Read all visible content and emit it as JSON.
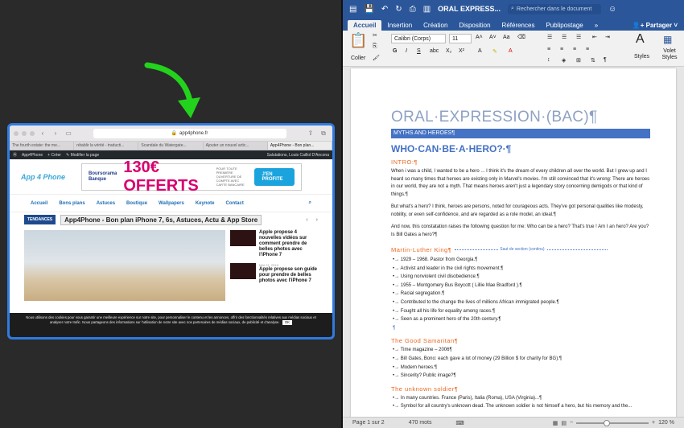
{
  "safari": {
    "url": "app4phone.fr",
    "tabs": [
      "The fourth estate: the me...",
      "rétablir la vérité - traducti...",
      "Scandale du Watergate...",
      "Ajouter un nouvel artic...",
      "App4Phone - Bon plan..."
    ],
    "wp_bar": {
      "site": "App4Phone",
      "new": "Créer",
      "edit": "Modifier la page",
      "greeting": "Salutations, Louis Caillol D'Ancona"
    },
    "logo": "App 4 Phone",
    "ad": {
      "bank": "Boursorama Banque",
      "big": "130€ OFFERTS",
      "small": "POUR TOUTE PREMIÈRE OUVERTURE DE COMPTE AVEC CARTE BANCAIRE",
      "cta": "J'EN PROFITE"
    },
    "nav": [
      "Accueil",
      "Bons plans",
      "Astuces",
      "Boutique",
      "Wallpapers",
      "Keynote",
      "Contact"
    ],
    "trend_label": "TENDANCES",
    "trend_title": "App4Phone - Bon plan iPhone 7, 6s, Astuces, Actu & App Store",
    "side": [
      {
        "text": "Apple propose 4 nouvelles vidéos sur comment prendre de belles photos avec l'iPhone 7",
        "date": ""
      },
      {
        "text": "Apple propose son guide pour prendre de belles photos avec l'iPhone 7",
        "date": "MAI 21, 2019"
      }
    ],
    "cookie": "Nous utilisons des cookies pour vous garantir une meilleure expérience sur notre site, pour personnaliser le contenu et les annonces, offrir des fonctionnalités relatives aux médias sociaux et analyser notre trafic. Nous partageons des informations sur l'utilisation de notre site avec nos partenaires de médias sociaux, de publicité et d'analyse.",
    "cookie_ok": "OK"
  },
  "word": {
    "doc_title": "ORAL EXPRESS...",
    "search_placeholder": "Rechercher dans le document",
    "tabs": [
      "Accueil",
      "Insertion",
      "Création",
      "Disposition",
      "Références",
      "Publipostage"
    ],
    "share": "Partager",
    "ribbon": {
      "paste": "Coller",
      "font": "Calibri (Corps)",
      "size": "11",
      "styles": "Styles",
      "pane": "Volet Styles"
    },
    "doc": {
      "h1": "ORAL·EXPRESSION·(BAC)¶",
      "banner": "MYTHS AND HEROES¶",
      "h2": "WHO·CAN·BE·A·HERO?·¶",
      "intro": "INTRO:¶",
      "p1": "When i was a child, I wanted to be a hero ... I think it's the dream of every children all over the world. But I grew up and I heard so many times that heroes are existing only in Marvel's movies. I'm still convinced that it's wrong: There are heroes in our world, they are not a myth. That means heroes aren't just a legendary story concerning demigods or that kind of things.¶",
      "p2": "But what's a hero? I think, heroes are persons, noted for courageous acts. They've got personal qualities like modesty, nobility, or even self-confidence, and are regarded as a role model, an ideal.¶",
      "p3": "And now, this constatation raises the following question for me: Who can be a hero? That's true ! Am I an hero? Are you? Is Bill Gates a hero?¶",
      "section_break": "Saut de section (continu)",
      "mlk": "Martin-Luther King¶",
      "mlk_items": [
        "1929 – 1968. Pastor from Georgia.¶",
        "Activist and leader in the civil rights movement.¶",
        "Using nonviolent civil disobedience.¶",
        "1955 – Montgomery Bus Boycott ( Lillie Mae Bradford ).¶",
        "Racial segregation.¶",
        "Contributed to the change the lives of millions African immigrated people.¶",
        "Fought all his life for equality among races.¶",
        "Seen as a prominent hero of the 20th century.¶"
      ],
      "samaritan": "The Good Samaritan¶",
      "sam_items": [
        "Time magazine – 2006¶",
        "Bill Gates, Bono: each gave a lot of money (29 Billion $ for charity for BG).¶",
        "Modern heroes.¶",
        "Sincerity? Public image?¶"
      ],
      "soldier": "The unknown soldier¶",
      "sol_items": [
        "In many countries. France (Paris), Italia (Roma), USA (Virginia)...¶",
        "Symbol for all country's unknown dead. The unknown soldier is not himself a hero, but his memory and the..."
      ]
    },
    "status": {
      "page": "Page 1 sur 2",
      "words": "470 mots",
      "zoom": "120 %"
    }
  }
}
